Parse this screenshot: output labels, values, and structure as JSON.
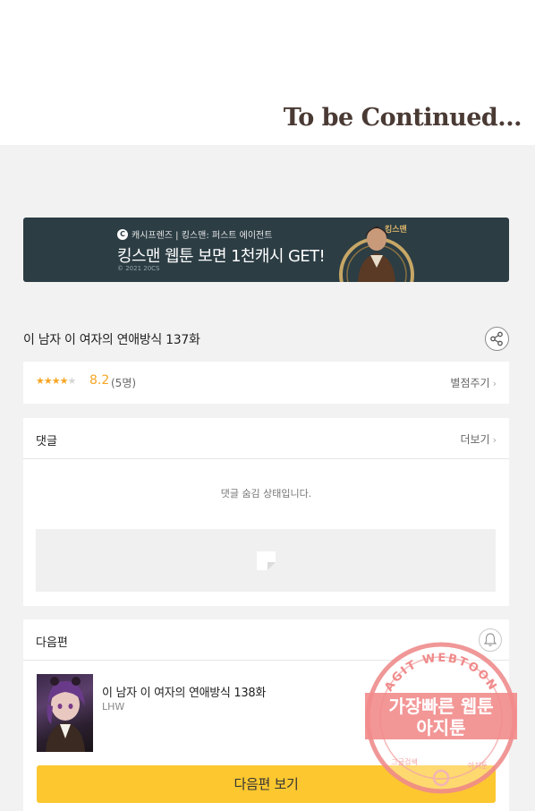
{
  "end_banner": {
    "text": "To be Continued..."
  },
  "ad_banner": {
    "brand_logo": "C",
    "brand_text": "캐시프렌즈 | 킹스맨: 퍼스트 에이전트",
    "headline": "킹스맨 웹툰 보면 1천캐시 GET!",
    "copyright": "© 2021 20CS",
    "poster_title": "킹스맨",
    "colors": {
      "background": "#2c3d44",
      "accent": "#d8b36a"
    }
  },
  "episode": {
    "title": "이 남자 이 여자의 연애방식 137화",
    "share_icon": "share-icon"
  },
  "rating": {
    "stars": "★★★★",
    "star_off": "★",
    "filled_stars": 4,
    "score": "8.2",
    "count": "(5명)",
    "rate_label": "별점주기",
    "chevron": "›",
    "colors": {
      "star": "#f5a623"
    }
  },
  "comments": {
    "header": "댓글",
    "more_label": "더보기",
    "chevron": "›",
    "hidden_message": "댓글 숨김 상태입니다."
  },
  "next_episode": {
    "header": "다음편",
    "bell_icon": "bell-icon",
    "title": "이 남자 이 여자의 연애방식 138화",
    "author": "LHW",
    "button_label": "다음편 보기",
    "colors": {
      "button": "#fcc72f"
    }
  },
  "watermark": {
    "ring_text": "AGIT WEBTOON",
    "line1": "가장빠른 웹툰",
    "line2": "아지툰",
    "bottom_left": "그글검색",
    "bottom_right": "아지툰"
  }
}
